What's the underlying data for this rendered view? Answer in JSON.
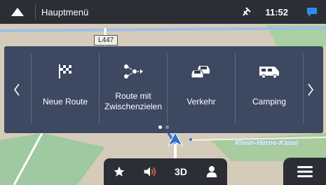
{
  "topbar": {
    "title": "Hauptmenü",
    "time": "11:52"
  },
  "map": {
    "road_label": "L447",
    "city_label": "Rhein-Herne-Kanal"
  },
  "menu": {
    "items": [
      {
        "label": "Neue Route",
        "icon": "checkered-flag-icon"
      },
      {
        "label": "Route mit Zwischenzielen",
        "icon": "waypoints-icon"
      },
      {
        "label": "Verkehr",
        "icon": "traffic-cars-icon"
      },
      {
        "label": "Camping",
        "icon": "camper-icon"
      }
    ],
    "page_count": 2,
    "active_page": 1
  },
  "bottombar": {
    "favorites_icon": "star-icon",
    "volume_icon": "speaker-icon",
    "view_mode_label": "3D",
    "user_icon": "user-icon"
  },
  "colors": {
    "bar_bg": "#2c2e35",
    "panel_bg": "#323e5a",
    "accent": "#3a8de0",
    "message_icon": "#2d8cf0"
  }
}
